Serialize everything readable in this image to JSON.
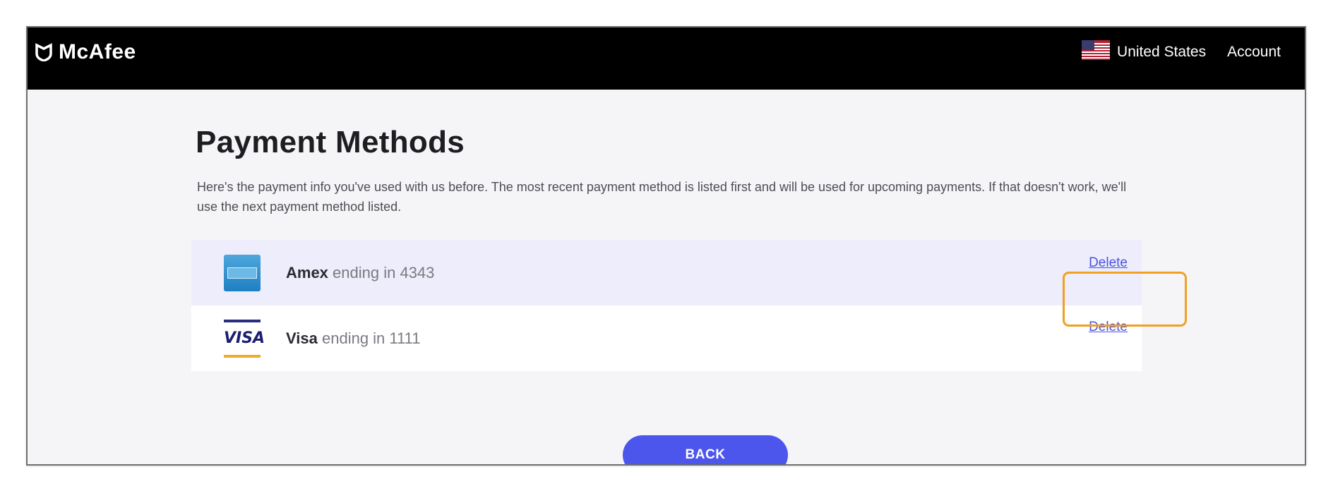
{
  "header": {
    "logo_text": "McAfee",
    "logo_icon": "mcafee-shield-icon",
    "country_flag_icon": "us-flag-icon",
    "country": "United States",
    "account_label": "Account"
  },
  "page": {
    "title": "Payment Methods",
    "description": "Here's the payment info you've used with us before. The most recent payment method is listed first and will be used for upcoming payments. If that doesn't work, we'll use the next payment method listed."
  },
  "payment_methods": [
    {
      "brand": "Amex",
      "detail": "ending in 4343",
      "icon": "amex-card-icon",
      "delete_label": "Delete",
      "selected": true
    },
    {
      "brand": "Visa",
      "detail": "ending in 1111",
      "icon": "visa-card-icon",
      "icon_text": "VISA",
      "delete_label": "Delete",
      "selected": false
    }
  ],
  "back_button_label": "BACK",
  "colors": {
    "header_bg": "#000000",
    "accent_button": "#4c56ec",
    "link": "#4a55e0",
    "highlight_border": "#f2a021",
    "selected_row_bg": "#ededfb"
  }
}
